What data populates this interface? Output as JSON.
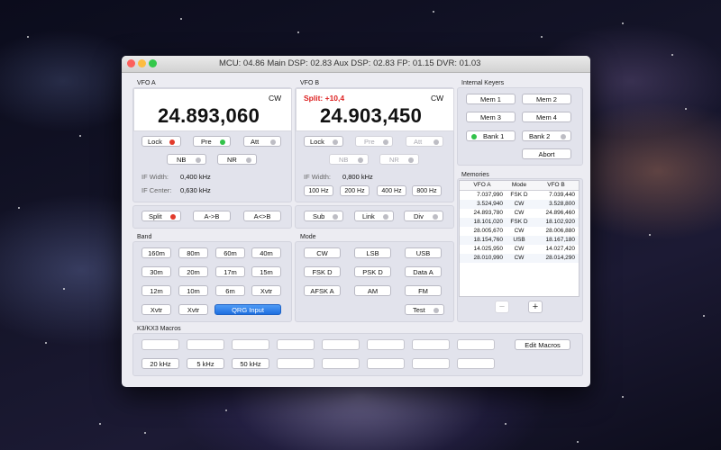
{
  "titlebar": {
    "title": "MCU: 04.86  Main DSP: 02.83  Aux DSP: 02.83  FP: 01.15  DVR: 01.03"
  },
  "vfo_a": {
    "label": "VFO A",
    "mode": "CW",
    "frequency": "24.893,060",
    "lock": "Lock",
    "pre": "Pre",
    "att": "Att",
    "nb": "NB",
    "nr": "NR",
    "if_width_label": "IF Width:",
    "if_width": "0,400 kHz",
    "if_center_label": "IF Center:",
    "if_center": "0,630 kHz"
  },
  "vfo_b": {
    "label": "VFO B",
    "split": "Split: +10,4",
    "mode": "CW",
    "frequency": "24.903,450",
    "lock": "Lock",
    "pre": "Pre",
    "att": "Att",
    "nb": "NB",
    "nr": "NR",
    "if_width_label": "IF Width:",
    "if_width": "0,800 kHz",
    "filters": [
      "100 Hz",
      "200 Hz",
      "400 Hz",
      "800 Hz"
    ]
  },
  "controls_a": {
    "split": "Split",
    "a_to_b": "A->B",
    "swap": "A<>B"
  },
  "controls_b": {
    "sub": "Sub",
    "link": "Link",
    "div": "Div"
  },
  "band": {
    "label": "Band",
    "buttons": [
      "160m",
      "80m",
      "60m",
      "40m",
      "30m",
      "20m",
      "17m",
      "15m",
      "12m",
      "10m",
      "6m",
      "Xvtr",
      "Xvtr",
      "Xvtr"
    ],
    "qrg": "QRG Input"
  },
  "mode_group": {
    "label": "Mode",
    "buttons": [
      "CW",
      "LSB",
      "USB",
      "FSK D",
      "PSK D",
      "Data A",
      "AFSK A",
      "AM",
      "FM"
    ],
    "test": "Test"
  },
  "keyers": {
    "label": "Internal Keyers",
    "mem1": "Mem 1",
    "mem2": "Mem 2",
    "mem3": "Mem 3",
    "mem4": "Mem 4",
    "bank1": "Bank 1",
    "bank2": "Bank 2",
    "abort": "Abort"
  },
  "memories": {
    "label": "Memories",
    "headers": [
      "VFO A",
      "Mode",
      "VFO B"
    ],
    "rows": [
      [
        "7.037,990",
        "FSK D",
        "7.039,440"
      ],
      [
        "3.524,940",
        "CW",
        "3.528,800"
      ],
      [
        "24.893,780",
        "CW",
        "24.896,460"
      ],
      [
        "18.101,020",
        "FSK D",
        "18.102,920"
      ],
      [
        "28.005,670",
        "CW",
        "28.006,880"
      ],
      [
        "18.154,760",
        "USB",
        "18.167,180"
      ],
      [
        "14.025,950",
        "CW",
        "14.027,420"
      ],
      [
        "28.010,990",
        "CW",
        "28.014,290"
      ]
    ],
    "minus": "−",
    "plus": "+"
  },
  "macros": {
    "label": "K3/KX3 Macros",
    "steps": [
      "20 kHz",
      "5 kHz",
      "50 kHz"
    ],
    "edit": "Edit Macros"
  },
  "colors": {
    "led_red": "#e23b2c",
    "led_green": "#32c24a",
    "split_red": "#dd2222",
    "accent_blue": "#1f6fe0"
  }
}
